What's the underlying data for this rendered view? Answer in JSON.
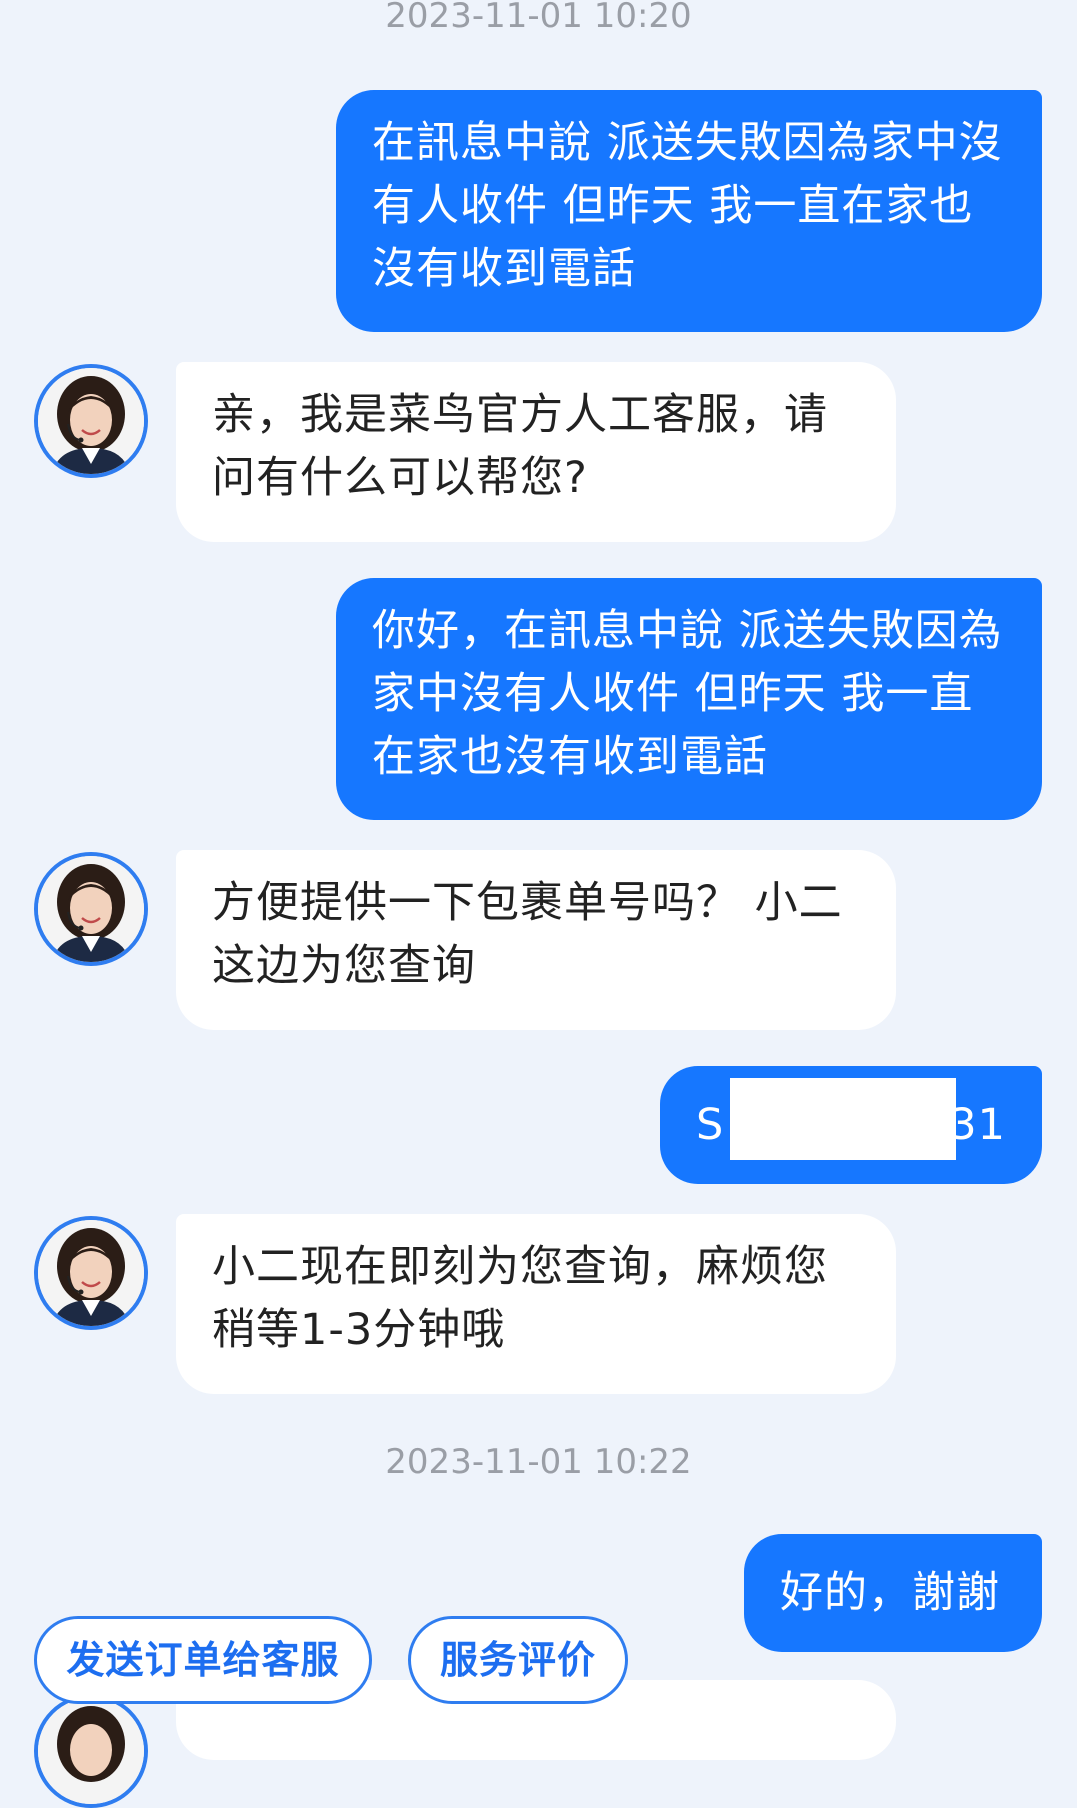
{
  "conversation": {
    "timestamps": [
      "2023-11-01 10:20",
      "2023-11-01 10:22"
    ],
    "messages": [
      {
        "from": "user",
        "text": "在訊息中說 派送失敗因為家中沒有人收件 但昨天 我一直在家也沒有收到電話"
      },
      {
        "from": "agent",
        "text": "亲，我是菜鸟官方人工客服，请问有什么可以帮您?"
      },
      {
        "from": "user",
        "text": "你好，在訊息中說 派送失敗因為家中沒有人收件 但昨天 我一直在家也沒有收到電話"
      },
      {
        "from": "agent",
        "text": "方便提供一下包裹单号吗？ 小二这边为您查询"
      },
      {
        "from": "user",
        "text_prefix": "S",
        "text_suffix": "31",
        "redacted": true
      },
      {
        "from": "agent",
        "text": "小二现在即刻为您查询，麻烦您稍等1-3分钟哦"
      },
      {
        "from": "user",
        "text": "好的，謝謝"
      }
    ]
  },
  "quick_actions": {
    "send_order": "发送订单给客服",
    "rate_service": "服务评价"
  },
  "colors": {
    "background": "#eef3fb",
    "user_bubble": "#1677ff",
    "agent_bubble": "#ffffff",
    "accent": "#2f7df0",
    "timestamp_text": "#9a9ea6"
  },
  "icons": {
    "agent_avatar": "customer-service-agent-avatar"
  }
}
